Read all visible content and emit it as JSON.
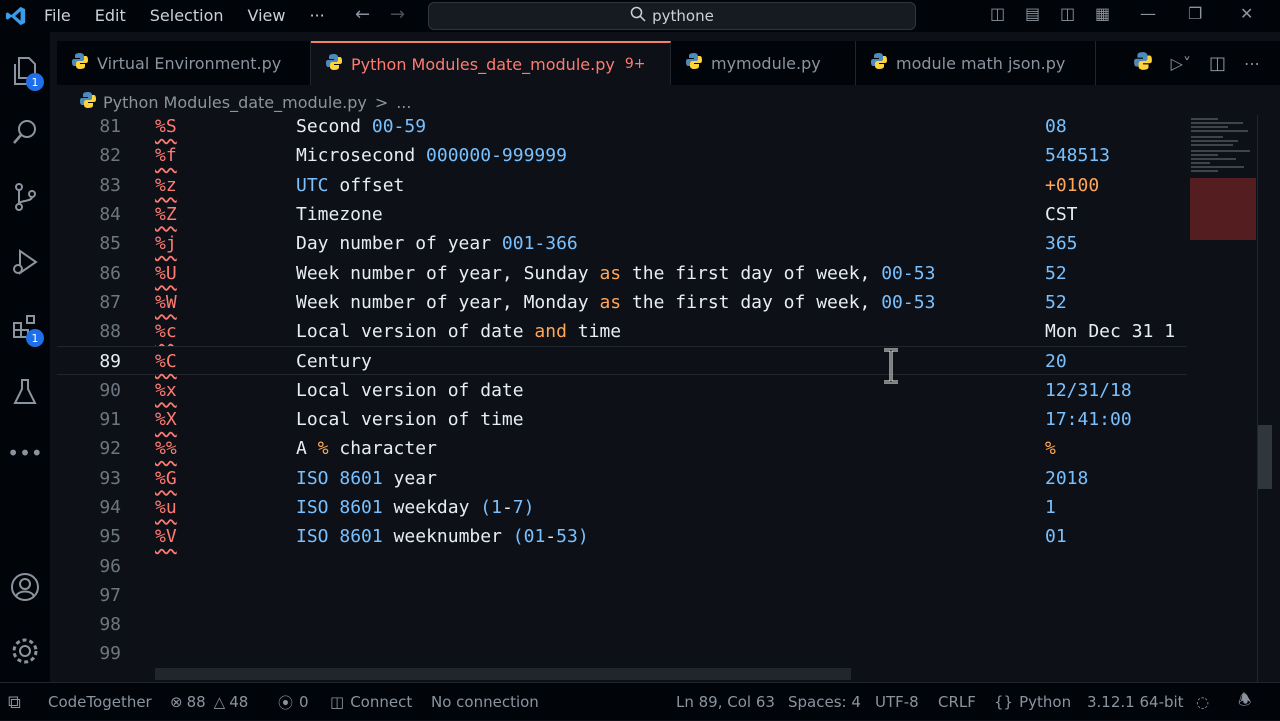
{
  "menu": {
    "file": "File",
    "edit": "Edit",
    "selection": "Selection",
    "view": "View",
    "more": "···"
  },
  "search": {
    "text": "pythone"
  },
  "tabs": [
    {
      "label": "Virtual Environment.py",
      "active": false
    },
    {
      "label": "Python Modules_date_module.py",
      "active": true,
      "modified": "9+"
    },
    {
      "label": "mymodule.py",
      "active": false
    },
    {
      "label": "module math json.py",
      "active": false
    }
  ],
  "badges": {
    "explorer": "1",
    "extensions": "1"
  },
  "breadcrumb": {
    "file": "Python Modules_date_module.py",
    "sep": ">",
    "more": "..."
  },
  "lines": [
    {
      "n": "81",
      "fmt": "%S",
      "desc": "Second ",
      "num": "00-59",
      "ex": "08"
    },
    {
      "n": "82",
      "fmt": "%f",
      "desc": "Microsecond ",
      "num": "000000-999999",
      "ex": "548513"
    },
    {
      "n": "83",
      "fmt": "%z",
      "desc": "UTC offset",
      "ex": "+0100"
    },
    {
      "n": "84",
      "fmt": "%Z",
      "desc": "Timezone",
      "ex": "CST"
    },
    {
      "n": "85",
      "fmt": "%j",
      "desc": "Day number of year ",
      "num": "001-366",
      "ex": "365"
    },
    {
      "n": "86",
      "fmt": "%U",
      "desc1": "Week number of year, Sunday ",
      "kw": "as",
      "desc2": " the first day of week, ",
      "num": "00-53",
      "ex": "52"
    },
    {
      "n": "87",
      "fmt": "%W",
      "desc1": "Week number of year, Monday ",
      "kw": "as",
      "desc2": " the first day of week, ",
      "num": "00-53",
      "ex": "52"
    },
    {
      "n": "88",
      "fmt": "%c",
      "desc1": "Local version of date ",
      "kw": "and",
      "desc2": " time",
      "ex": "Mon Dec 31 1"
    },
    {
      "n": "89",
      "fmt": "%C",
      "desc": "Century",
      "ex": "20"
    },
    {
      "n": "90",
      "fmt": "%x",
      "desc": "Local version of date",
      "ex": "12/31/18"
    },
    {
      "n": "91",
      "fmt": "%X",
      "desc": "Local version of time",
      "ex": "17:41:00"
    },
    {
      "n": "92",
      "fmt": "%%",
      "desc1": "A ",
      "kw": "%",
      "desc2": " character",
      "ex": "%"
    },
    {
      "n": "93",
      "fmt": "%G",
      "desc": "ISO 8601 year",
      "ex": "2018"
    },
    {
      "n": "94",
      "fmt": "%u",
      "desc": "ISO 8601 weekday (1-7)",
      "ex": "1"
    },
    {
      "n": "95",
      "fmt": "%V",
      "desc": "ISO 8601 weeknumber (01-53)",
      "ex": "01"
    },
    {
      "n": "96"
    },
    {
      "n": "97"
    },
    {
      "n": "98"
    },
    {
      "n": "99"
    }
  ],
  "status": {
    "codetogether": "CodeTogether",
    "errors": "88",
    "warnings": "48",
    "ports": "0",
    "connect": "Connect",
    "no_connection": "No connection",
    "position": "Ln 89, Col 63",
    "spaces": "Spaces: 4",
    "encoding": "UTF-8",
    "eol": "CRLF",
    "language": "Python",
    "interpreter": "3.12.1 64-bit"
  },
  "colors": {
    "accent": "#f78166",
    "badge": "#1f6feb",
    "format": "#ff7b72",
    "number": "#79c0ff",
    "keyword": "#ffa657"
  }
}
